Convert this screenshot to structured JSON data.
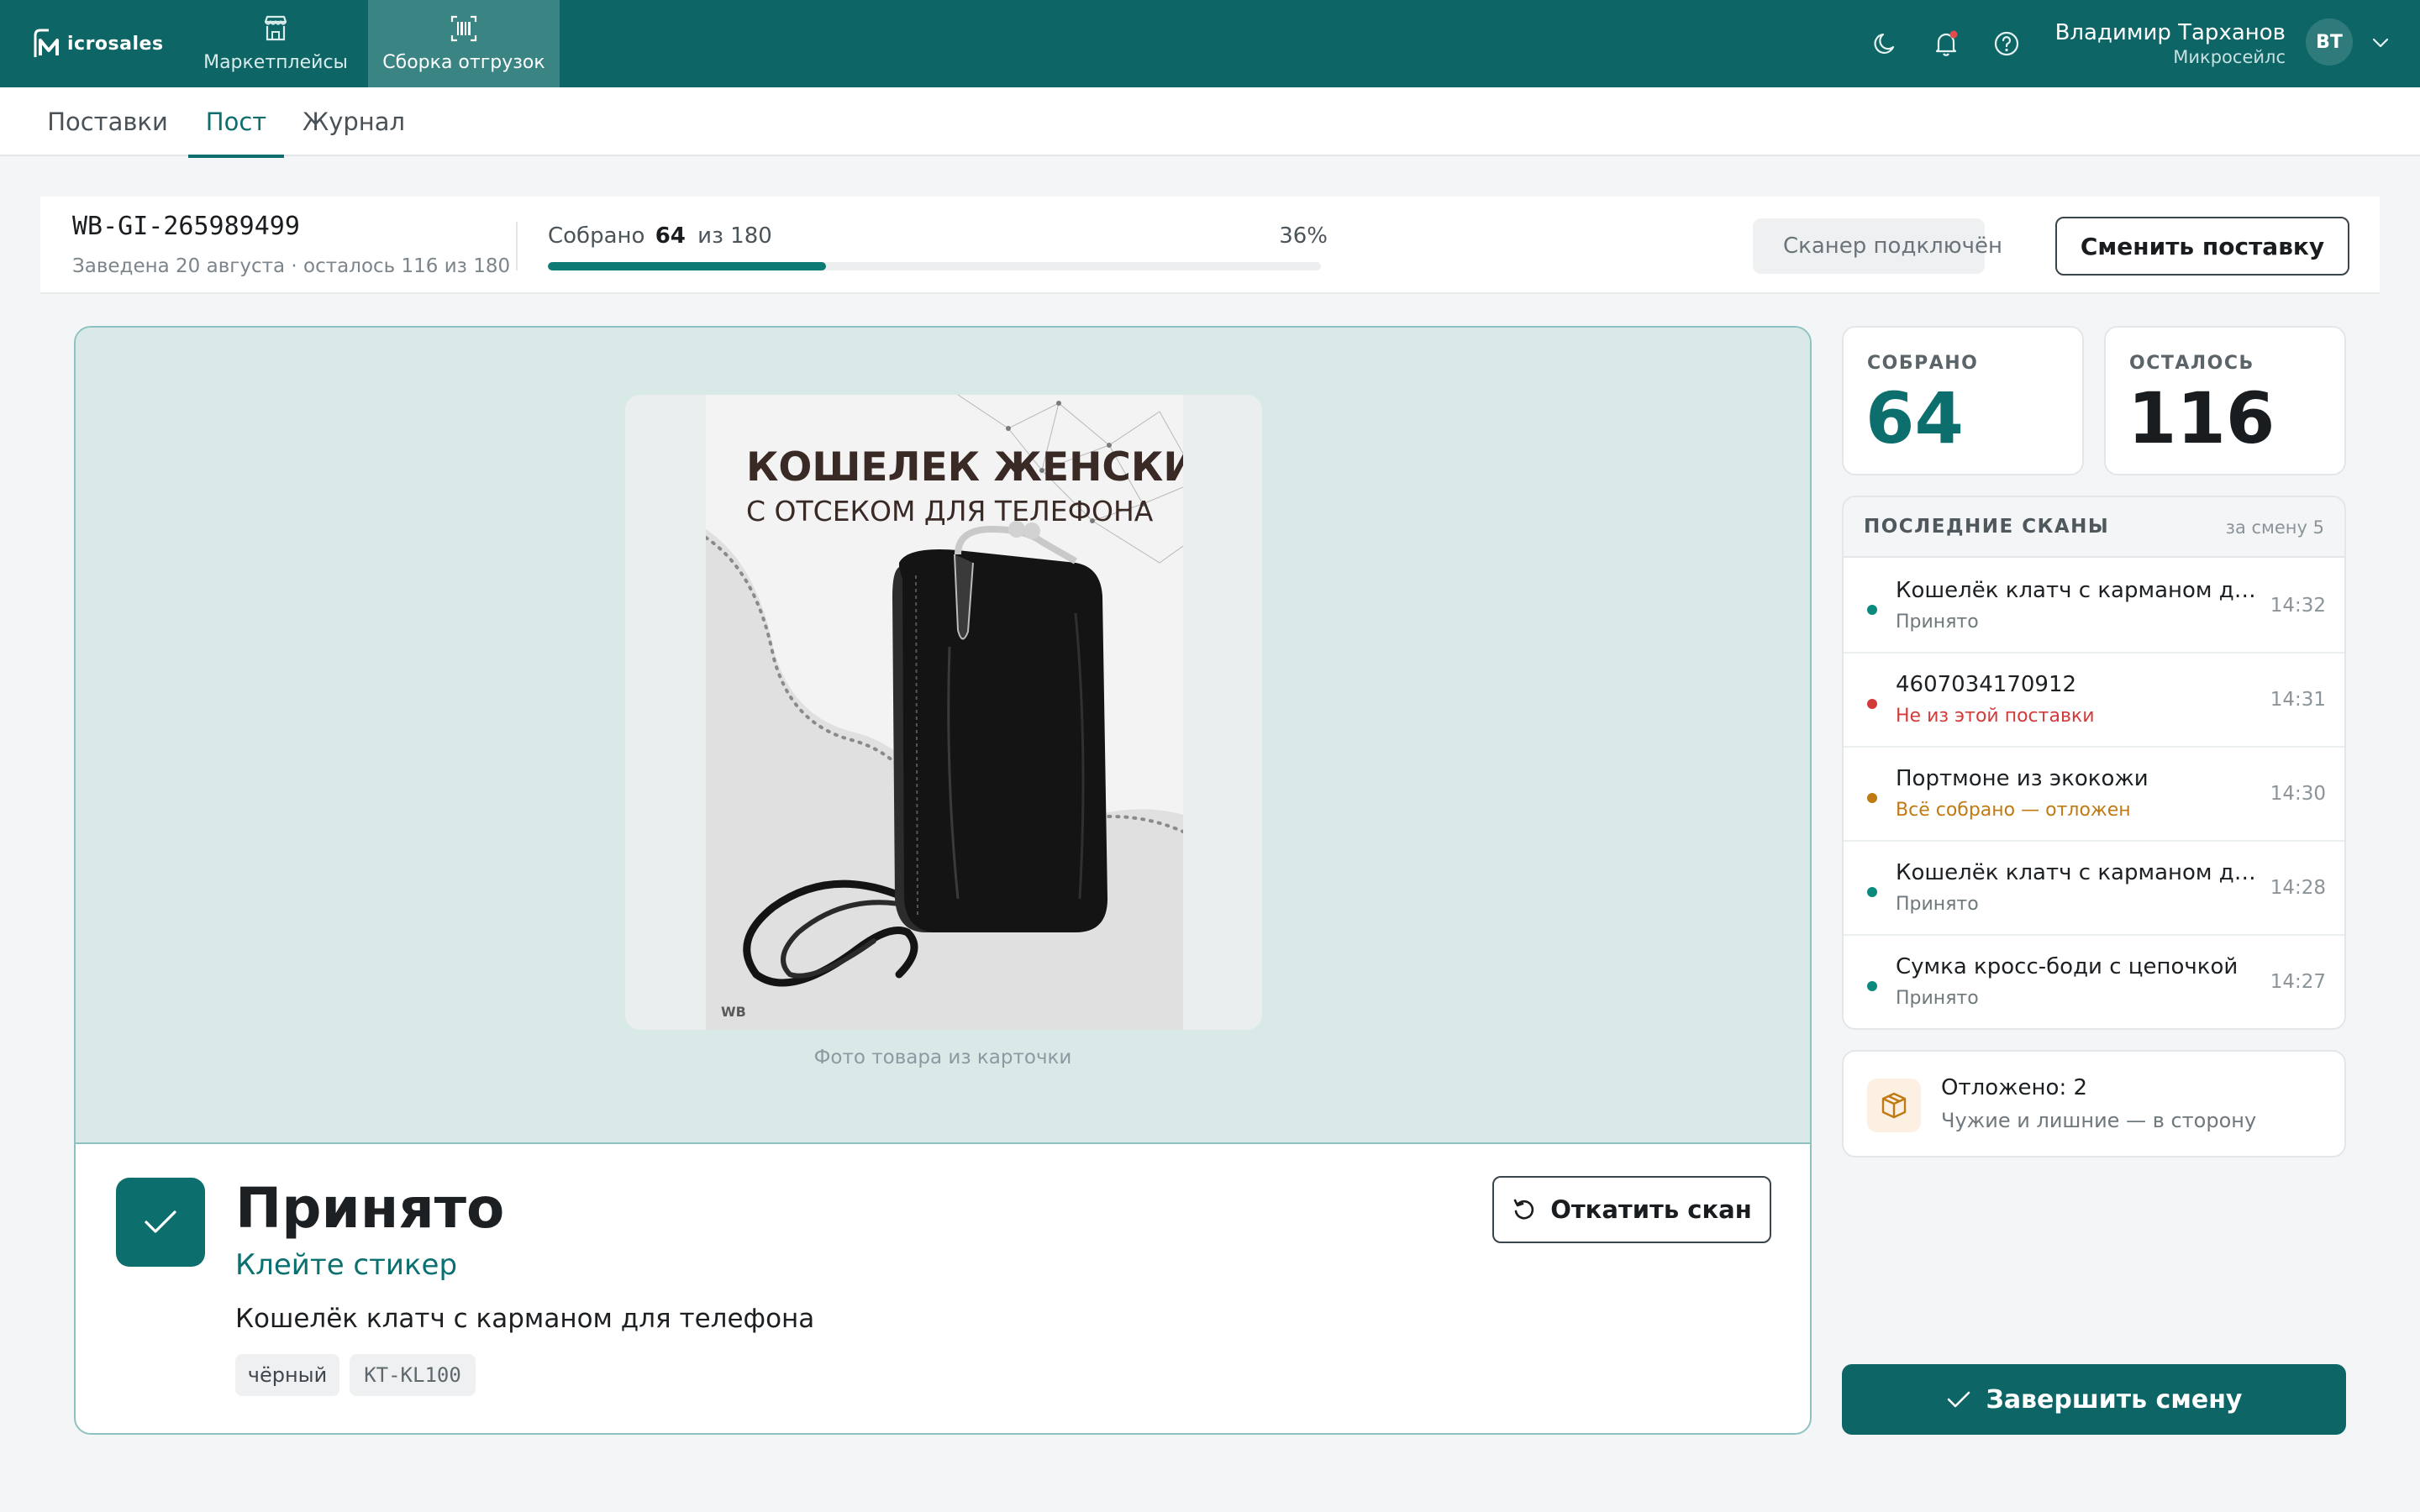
{
  "app": {
    "logo_text": "icrosales"
  },
  "topnav": [
    {
      "label": "Маркетплейсы",
      "icon": "store-icon"
    },
    {
      "label": "Сборка отгрузок",
      "icon": "barcode-scanner-icon",
      "active": true
    }
  ],
  "header_icons": [
    "moon-icon",
    "bell-icon",
    "help-icon"
  ],
  "user": {
    "name": "Владимир Тарханов",
    "org": "Микросейлс",
    "initials": "ВТ"
  },
  "tabs": [
    {
      "label": "Поставки"
    },
    {
      "label": "Пост",
      "active": true
    },
    {
      "label": "Журнал"
    }
  ],
  "supply": {
    "code": "WB-GI-265989499",
    "meta": "Заведена 20 августа · осталось 116 из 180",
    "progress_prefix": "Собрано",
    "collected": "64",
    "progress_suffix": "из 180",
    "percent_text": "36%",
    "progress_fraction": 0.36,
    "scanner_status": "Сканер подключён",
    "change_button": "Сменить поставку"
  },
  "scan_result": {
    "photo": {
      "title_line1": "КОШЕЛЕК ЖЕНСКИЙ",
      "title_line2": "С ОТСЕКОМ ДЛЯ ТЕЛЕФОНА",
      "brand_mark": "WB"
    },
    "photo_caption": "Фото товара из карточки",
    "status_title": "Принято",
    "status_instruction": "Клейте стикер",
    "product_name": "Кошелёк клатч с карманом для телефона",
    "tags": [
      "чёрный",
      "KT-KL100"
    ],
    "rollback_button": "Откатить скан"
  },
  "stats": {
    "collected_label": "СОБРАНО",
    "collected_value": "64",
    "left_label": "ОСТАЛОСЬ",
    "left_value": "116"
  },
  "recent_scans": {
    "title": "ПОСЛЕДНИЕ СКАНЫ",
    "shift_count": "за смену 5",
    "items": [
      {
        "name": "Кошелёк клатч с карманом для телефона",
        "status": "Принято",
        "time": "14:32",
        "color": "#0d8a80"
      },
      {
        "name": "4607034170912",
        "status": "Не из этой поставки",
        "time": "14:31",
        "color": "#d33b3b"
      },
      {
        "name": "Портмоне из экокожи",
        "status": "Всё собрано — отложен",
        "time": "14:30",
        "color": "#c07a12"
      },
      {
        "name": "Кошелёк клатч с карманом для телефона",
        "status": "Принято",
        "time": "14:28",
        "color": "#0d8a80"
      },
      {
        "name": "Сумка кросс-боди с цепочкой",
        "status": "Принято",
        "time": "14:27",
        "color": "#0d8a80"
      }
    ]
  },
  "deferred": {
    "title": "Отложено: 2",
    "subtitle": "Чужие и лишние — в сторону"
  },
  "finish_button": "Завершить смену",
  "colors": {
    "brand": "#0d6566",
    "accent": "#0d6e6e",
    "success": "#0d8a80",
    "error": "#d33b3b",
    "warning": "#c07a12"
  }
}
